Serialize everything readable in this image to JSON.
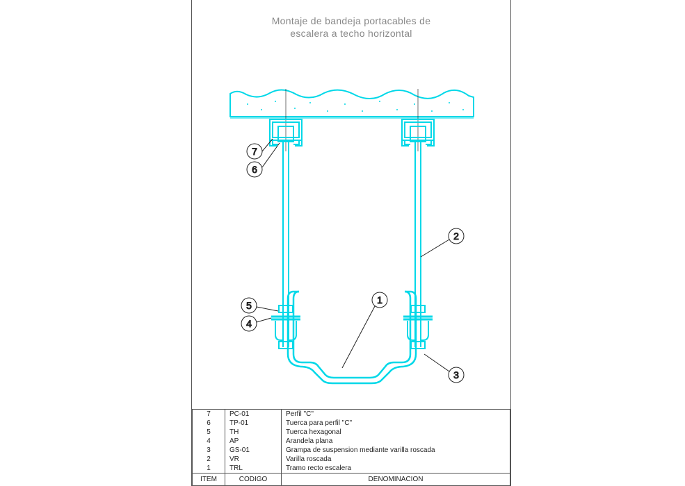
{
  "title": {
    "line1": "Montaje de bandeja portacables de",
    "line2": "escalera a techo horizontal"
  },
  "colors": {
    "line": "#00d8e8",
    "balloon_stroke": "#222222"
  },
  "balloons": {
    "b1": "1",
    "b2": "2",
    "b3": "3",
    "b4": "4",
    "b5": "5",
    "b6": "6",
    "b7": "7"
  },
  "table": {
    "headers": {
      "item": "ITEM",
      "code": "CODIGO",
      "desc": "DENOMINACION"
    },
    "rows": [
      {
        "item": "7",
        "code": "PC-01",
        "desc": "Perfil \"C\""
      },
      {
        "item": "6",
        "code": "TP-01",
        "desc": "Tuerca para perfil \"C\""
      },
      {
        "item": "5",
        "code": "TH",
        "desc": "Tuerca hexagonal"
      },
      {
        "item": "4",
        "code": "AP",
        "desc": "Arandela plana"
      },
      {
        "item": "3",
        "code": "GS-01",
        "desc": "Grampa de suspension mediante varilla roscada"
      },
      {
        "item": "2",
        "code": "VR",
        "desc": "Varilla roscada"
      },
      {
        "item": "1",
        "code": "TRL",
        "desc": "Tramo recto escalera"
      }
    ]
  }
}
